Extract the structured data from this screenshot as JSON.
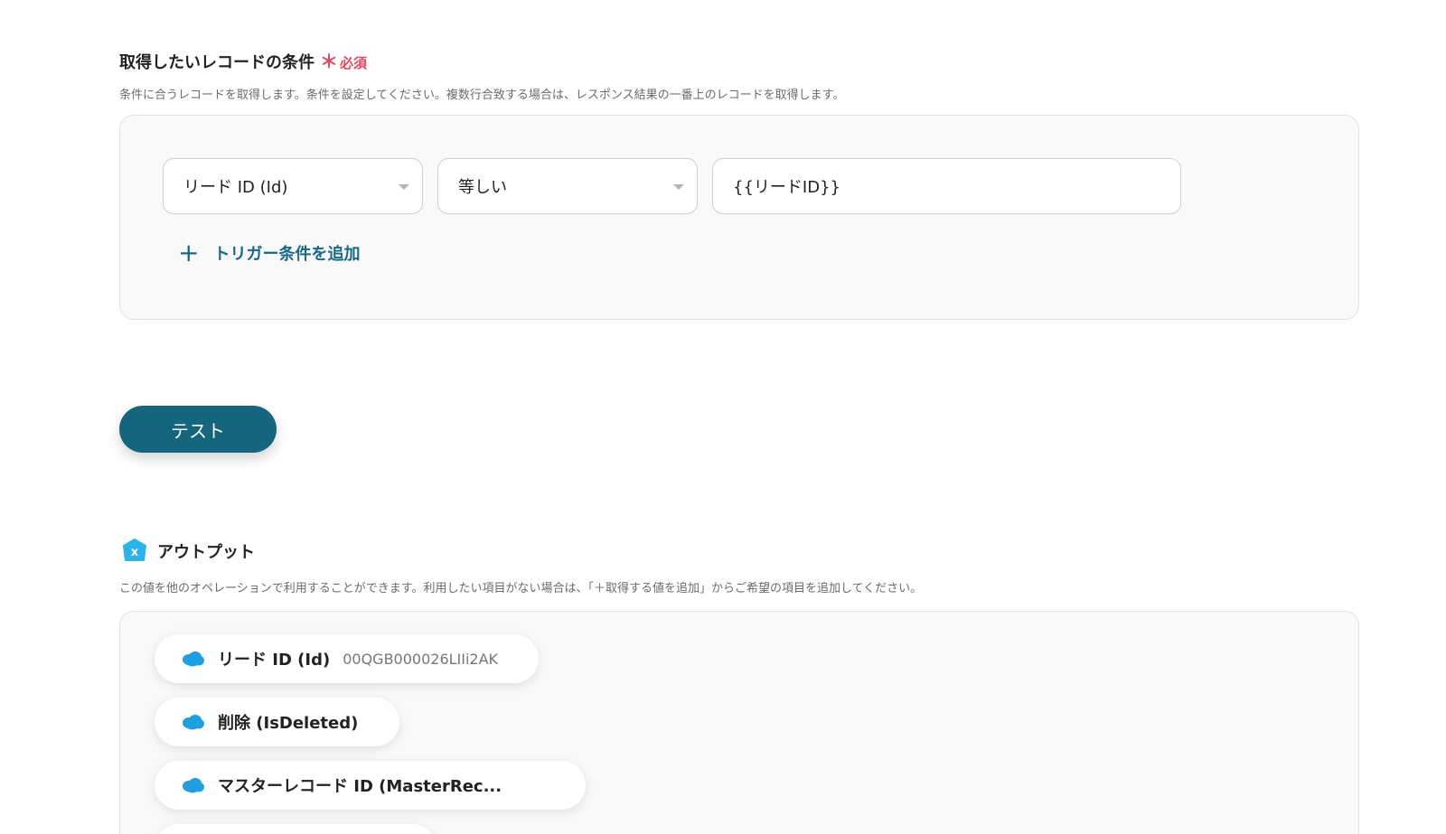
{
  "condition_section": {
    "title": "取得したいレコードの条件",
    "required_mark": "＊",
    "required_label": "必須",
    "description": "条件に合うレコードを取得します。条件を設定してください。複数行合致する場合は、レスポンス結果の一番上のレコードを取得します。",
    "field_select": "リード ID (Id)",
    "operator_select": "等しい",
    "value_input": "{{リードID}}",
    "add_trigger_label": "トリガー条件を追加"
  },
  "test_button_label": "テスト",
  "output_section": {
    "title": "アウトプット",
    "description": "この値を他のオペレーションで利用することができます。利用したい項目がない場合は、「＋取得する値を追加」からご希望の項目を追加してください。",
    "items": [
      {
        "label": "リード ID (Id)",
        "value": "00QGB000026LIIi2AK"
      },
      {
        "label": "削除 (IsDeleted)",
        "value": ""
      },
      {
        "label": "マスターレコード ID (MasterRec...",
        "value": ""
      },
      {
        "label": "",
        "value": ""
      }
    ]
  },
  "icons": {
    "salesforce_icon_color": "#1ea0e0",
    "output_logo_color": "#2bb5e6"
  },
  "colors": {
    "accent": "#15657f",
    "link": "#17698a",
    "required": "#e8445a"
  }
}
